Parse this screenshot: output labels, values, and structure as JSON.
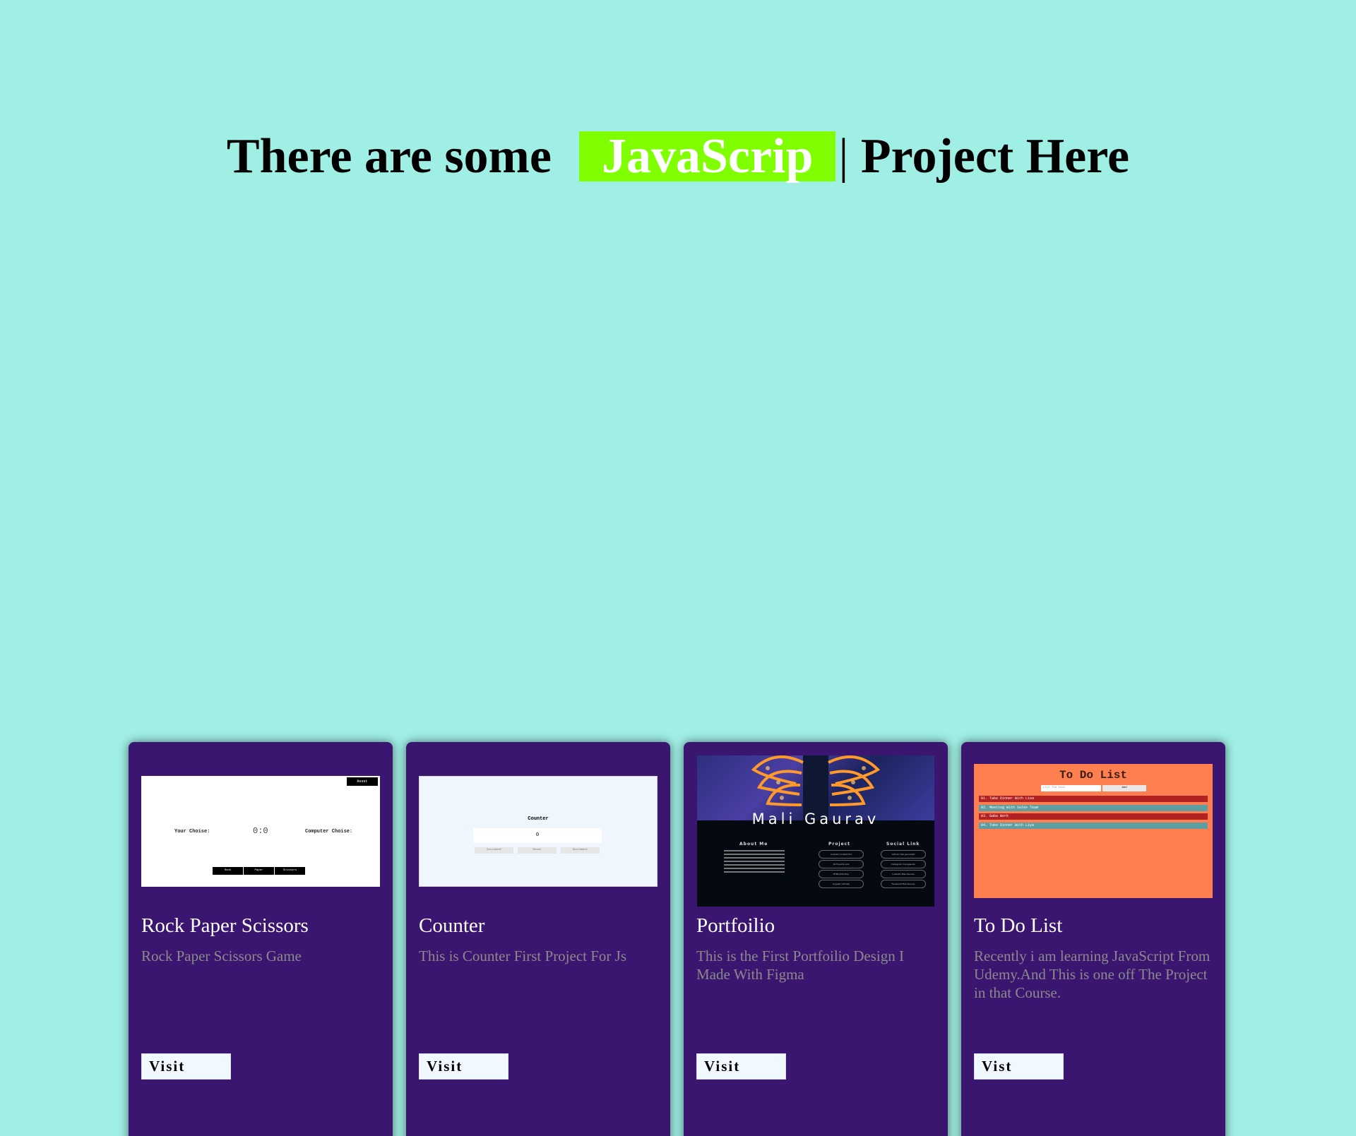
{
  "header": {
    "before": "There are some",
    "highlight": "JavaScrip",
    "cursor": "|",
    "after": "Project Here"
  },
  "colors": {
    "page_bg": "#a0efe5",
    "highlight_bg": "#7fff00",
    "card_bg": "#3b1670",
    "description": "#8a8a8a"
  },
  "cards": [
    {
      "title": "Rock Paper Scissors",
      "description": "Rock Paper Scissors Game",
      "button": "Visit",
      "thumb": {
        "reset": "Reset",
        "your_choice": "Your Choise:",
        "score": "0:0",
        "computer_choice": "Computer Choise:",
        "buttons": [
          "Rock",
          "Paper",
          "Scissors"
        ]
      }
    },
    {
      "title": "Counter",
      "description": "This is Counter First Project For Js",
      "button": "Visit",
      "thumb": {
        "heading": "Counter",
        "value": "0",
        "buttons": [
          "Increment",
          "Reset",
          "Decrement"
        ]
      }
    },
    {
      "title": "Portfoilio",
      "description": "This is the First Portfoilio Design I Made With Figma",
      "button": "Visit",
      "thumb": {
        "name": "Mali Gaurav",
        "about": "About Me",
        "project": "Project",
        "social": "Social Link",
        "project_items": [
          "Youtube Contact Pro",
          "JS Projects Link",
          "HTML/CSS Proj.",
          "Angular Githubs"
        ],
        "social_items": [
          "Github mali.gaurav95",
          "Instagram mali.gaurav",
          "LinkedIn Mali Gaurav",
          "Facebook Mali Gaurav"
        ]
      }
    },
    {
      "title": "To Do List",
      "description": "Recently i am learning JavaScript From Udemy.And This is one off The Project in that Course.",
      "button": "Vist",
      "thumb": {
        "heading": "To Do List",
        "input_placeholder": "List The task",
        "add": "Add",
        "items": [
          {
            "text": "01. Take Dinner With Lisa",
            "color": "#b22222"
          },
          {
            "text": "02. Meeting With Sales Team",
            "color": "#5f9ea0"
          },
          {
            "text": "03. Gaba Work",
            "color": "#b22222"
          },
          {
            "text": "04. Take Dinner With Liya",
            "color": "#5f9ea0"
          }
        ]
      }
    }
  ]
}
